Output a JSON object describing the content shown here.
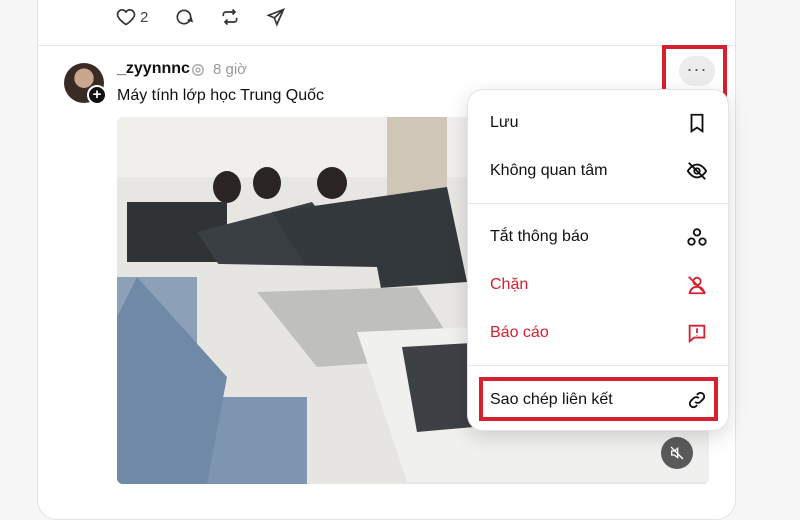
{
  "post_actions": {
    "like_count": "2"
  },
  "post": {
    "username": "_zyynnnc",
    "time": "8 giờ",
    "caption": "Máy tính lớp học Trung Quốc"
  },
  "menu": {
    "items": [
      {
        "label": "Lưu",
        "icon": "bookmark-icon"
      },
      {
        "label": "Không quan tâm",
        "icon": "eye-off-icon"
      },
      {
        "label": "Tắt thông báo",
        "icon": "mute-notifications-icon"
      },
      {
        "label": "Chặn",
        "icon": "block-user-icon"
      },
      {
        "label": "Báo cáo",
        "icon": "report-icon"
      },
      {
        "label": "Sao chép liên kết",
        "icon": "link-icon"
      }
    ]
  },
  "colors": {
    "danger": "#d6202f",
    "highlight_border": "#d6202f",
    "text_primary": "#111111",
    "text_muted": "#999999"
  }
}
